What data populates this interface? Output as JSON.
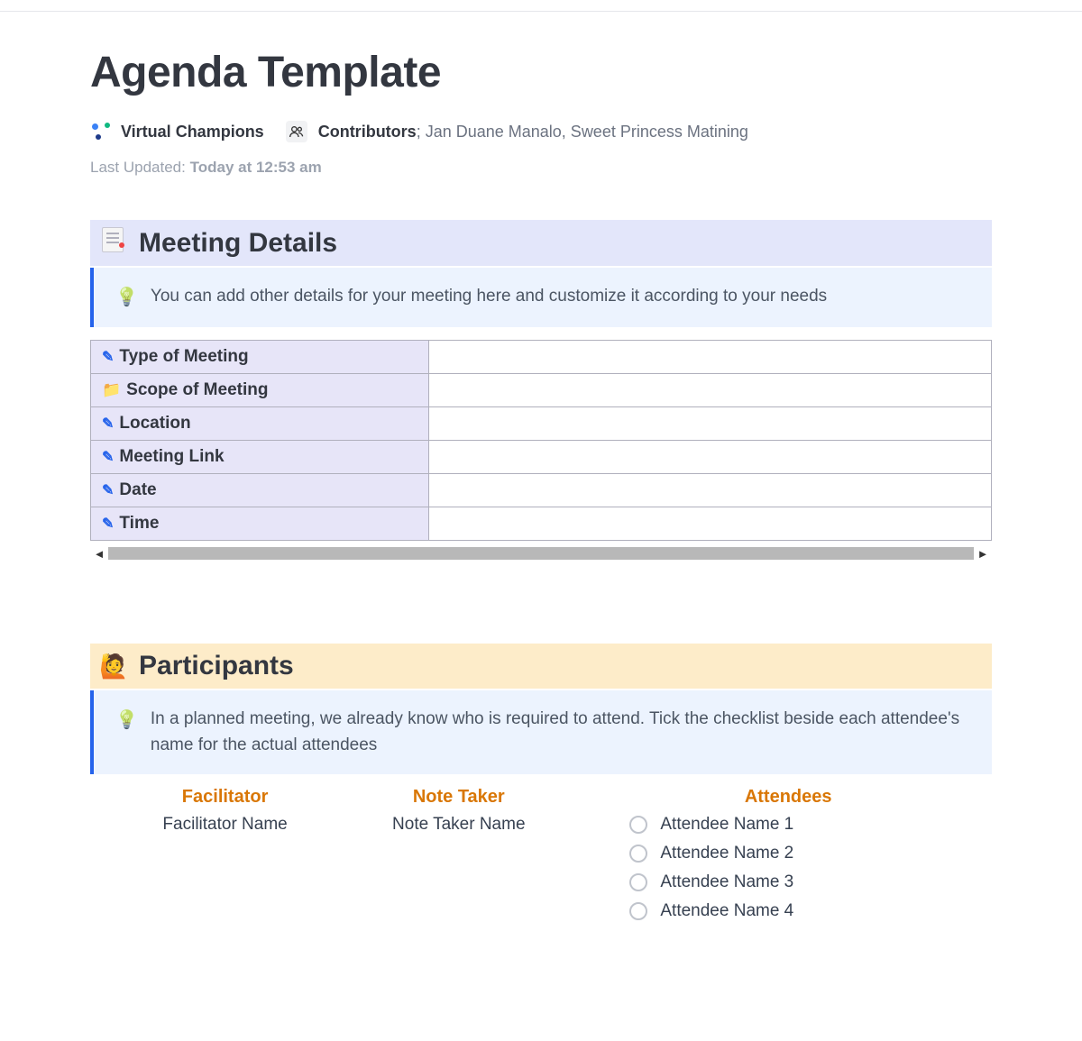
{
  "page": {
    "title": "Agenda Template",
    "team": "Virtual Champions",
    "contributors_label": "Contributors",
    "contributors": "Jan Duane Manalo, Sweet Princess Matining",
    "last_updated_label": "Last Updated:",
    "last_updated_value": "Today at 12:53 am"
  },
  "meeting_details": {
    "heading": "Meeting Details",
    "tip": "You can add other details for your meeting here and customize it according to your needs",
    "rows": [
      {
        "icon": "pencil",
        "label": "Type of Meeting",
        "value": ""
      },
      {
        "icon": "folder",
        "label": "Scope of Meeting",
        "value": ""
      },
      {
        "icon": "pencil",
        "label": "Location",
        "value": ""
      },
      {
        "icon": "pencil",
        "label": "Meeting Link",
        "value": ""
      },
      {
        "icon": "pencil",
        "label": "Date",
        "value": ""
      },
      {
        "icon": "pencil",
        "label": "Time",
        "value": ""
      }
    ]
  },
  "participants": {
    "heading": "Participants",
    "tip": "In a planned meeting, we already know who is required to attend. Tick the checklist beside each attendee's name for the actual attendees",
    "facilitator_label": "Facilitator",
    "facilitator_name": "Facilitator Name",
    "note_taker_label": "Note Taker",
    "note_taker_name": "Note Taker Name",
    "attendees_label": "Attendees",
    "attendees": [
      "Attendee Name 1",
      "Attendee Name 2",
      "Attendee Name 3",
      "Attendee Name 4"
    ]
  }
}
